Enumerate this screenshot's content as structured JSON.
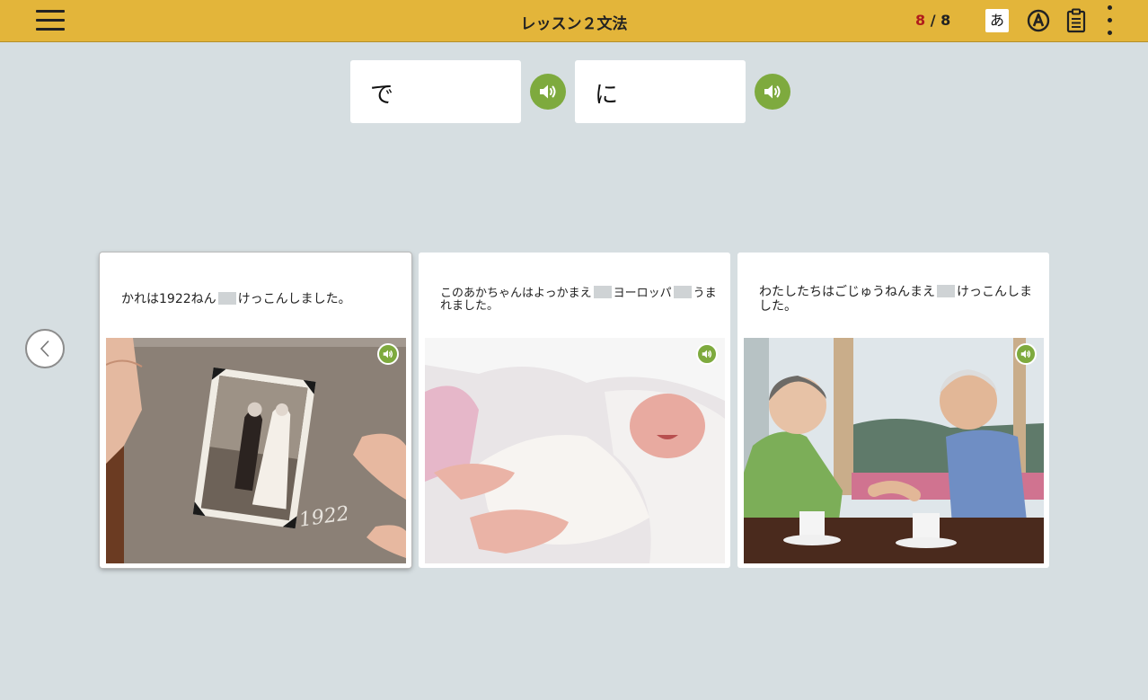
{
  "header": {
    "title": "レッスン２文法",
    "progress_current": "8",
    "progress_sep": " / ",
    "progress_total": "8",
    "kana_label": "あ"
  },
  "options": [
    {
      "text": "で"
    },
    {
      "text": "に"
    }
  ],
  "cards": [
    {
      "part1": "かれは1922ねん",
      "part2": "けっこんしました。",
      "selected": true
    },
    {
      "part1": "このあかちゃんはよっかまえ",
      "part2": "ヨーロッパ",
      "part3": "うまれました。",
      "selected": false
    },
    {
      "part1": "わたしたちはごじゅうねんまえ",
      "part2": "けっこんしました。",
      "selected": false
    }
  ],
  "colors": {
    "header_bg": "#e3b53a",
    "page_bg": "#d6dee1",
    "accent_green": "#7eaa3e",
    "progress_current": "#b01c1c"
  },
  "icons": {
    "menu": "hamburger-icon",
    "furigana": "kana-icon",
    "romaji": "circle-a-icon",
    "notes": "clipboard-icon",
    "more": "kebab-icon",
    "audio": "speaker-icon",
    "previous": "chevron-left-icon"
  }
}
